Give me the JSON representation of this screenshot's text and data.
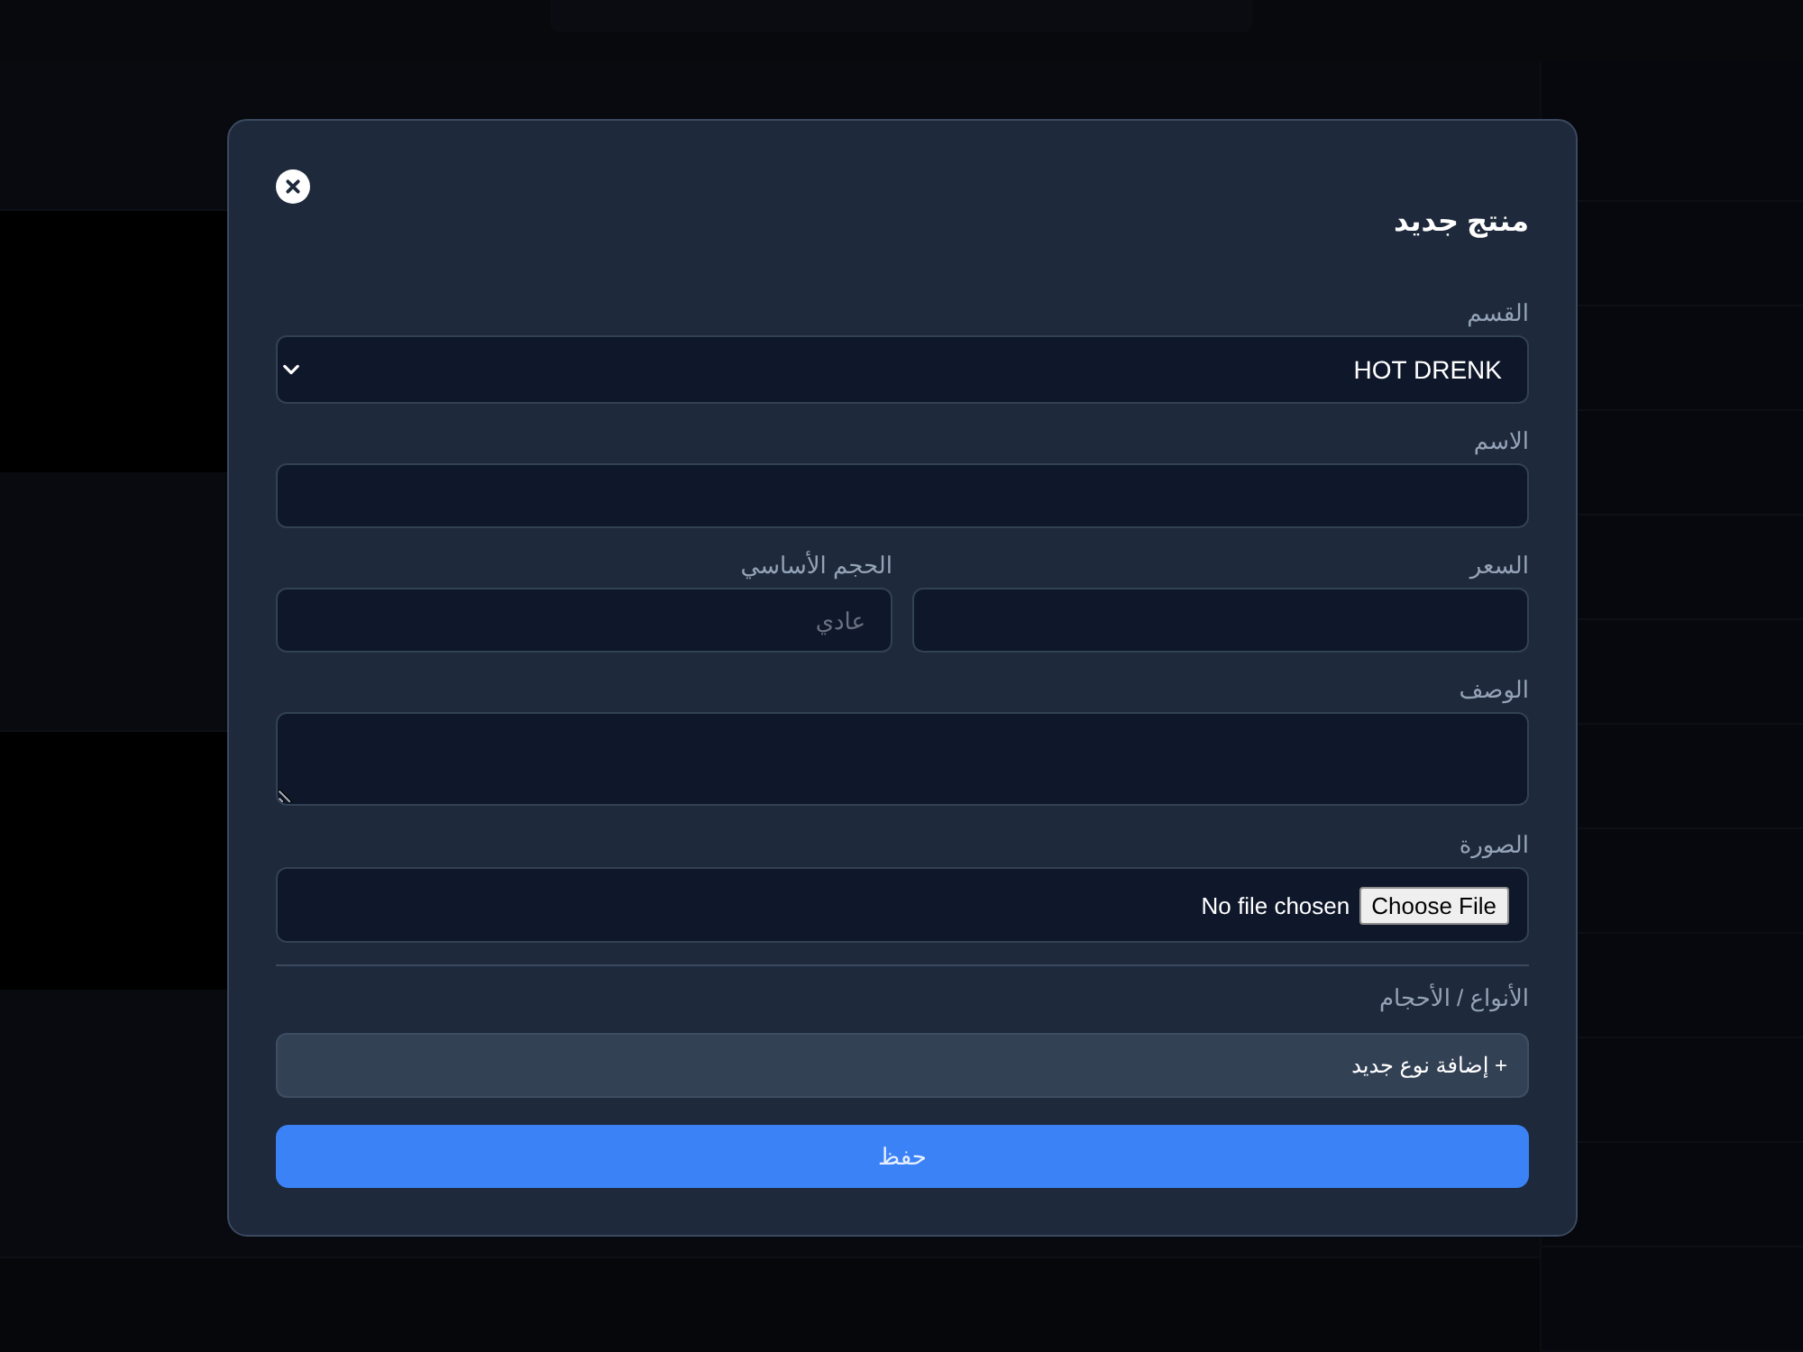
{
  "dialog": {
    "title": "منتج جديد",
    "category": {
      "label": "القسم",
      "value": "HOT DRENK"
    },
    "name": {
      "label": "الاسم"
    },
    "price": {
      "label": "السعر"
    },
    "base_size": {
      "label": "الحجم الأساسي",
      "placeholder": "عادي"
    },
    "description": {
      "label": "الوصف"
    },
    "image": {
      "label": "الصورة",
      "button": "Choose File",
      "status": "No file chosen"
    },
    "variants": {
      "label": "الأنواع / الأحجام",
      "add_button": "+ إضافة نوع جديد"
    },
    "save_button": "حفظ"
  }
}
